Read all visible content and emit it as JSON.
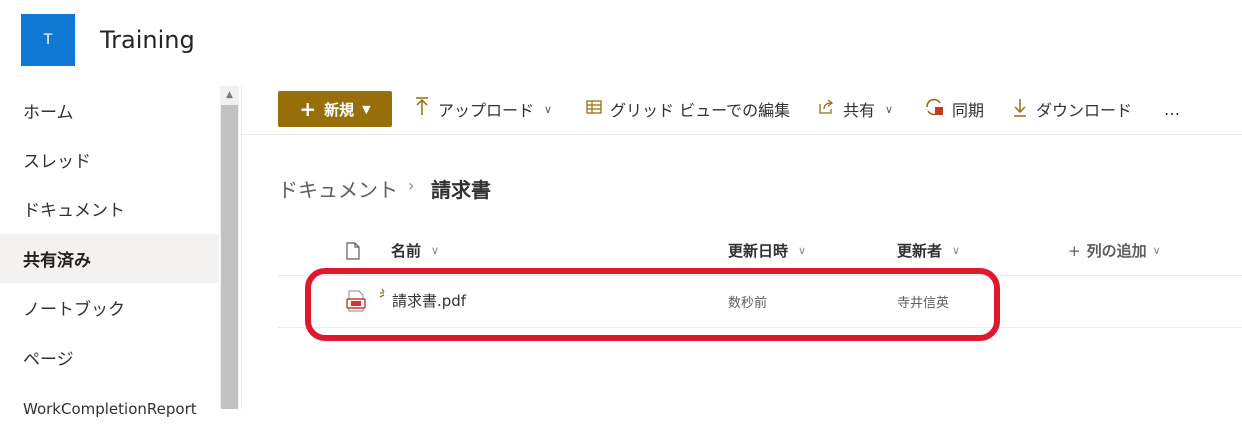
{
  "header": {
    "logo_letter": "T",
    "site_title": "Training"
  },
  "sidebar": {
    "items": [
      {
        "label": "ホーム"
      },
      {
        "label": "スレッド"
      },
      {
        "label": "ドキュメント"
      },
      {
        "label": "共有済み",
        "selected": true
      },
      {
        "label": "ノートブック"
      },
      {
        "label": "ページ"
      },
      {
        "label": "WorkCompletionReport"
      }
    ]
  },
  "commandbar": {
    "new_label": "新規",
    "upload_label": "アップロード",
    "grid_label": "グリッド ビューでの編集",
    "share_label": "共有",
    "sync_label": "同期",
    "download_label": "ダウンロード",
    "more_label": "…"
  },
  "breadcrumb": {
    "root": "ドキュメント",
    "separator": "›",
    "current": "請求書"
  },
  "table": {
    "columns": {
      "name": "名前",
      "modified": "更新日時",
      "modified_by": "更新者",
      "add_column": "列の追加",
      "add_plus": "+"
    },
    "rows": [
      {
        "name": "請求書.pdf",
        "modified": "数秒前",
        "modified_by": "寺井信英"
      }
    ]
  },
  "colors": {
    "brand": "#986f0b",
    "logo_bg": "#0f78d4",
    "highlight": "#e0182d"
  }
}
